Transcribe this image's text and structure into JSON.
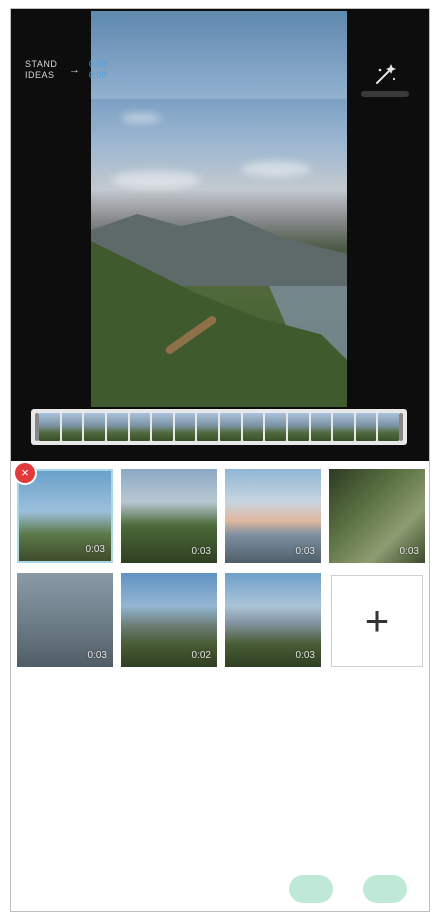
{
  "window": {
    "width": 435,
    "height": 918
  },
  "header": {
    "title_left": [
      "STAND",
      "IDEAS"
    ],
    "title_right": [
      "0:00",
      "0:00"
    ],
    "magic_icon": "magic-wand-icon"
  },
  "thumbnails": [
    {
      "duration": "0:03",
      "selected": true
    },
    {
      "duration": "0:03",
      "selected": false
    },
    {
      "duration": "0:03",
      "selected": false
    },
    {
      "duration": "0:03",
      "selected": false
    },
    {
      "duration": "0:03",
      "selected": false
    },
    {
      "duration": "0:02",
      "selected": false
    },
    {
      "duration": "0:03",
      "selected": false
    }
  ],
  "add_button": {
    "label": "+"
  },
  "delete_badge": {
    "label": "×"
  },
  "footer": {
    "left_button": "",
    "right_button": ""
  },
  "colors": {
    "editor_bg": "#0d0d0d",
    "accent_blue": "#4aa3df",
    "delete_red": "#e33b3b",
    "selection": "#a6d8e8",
    "footer_btn": "#bfe9d6"
  }
}
